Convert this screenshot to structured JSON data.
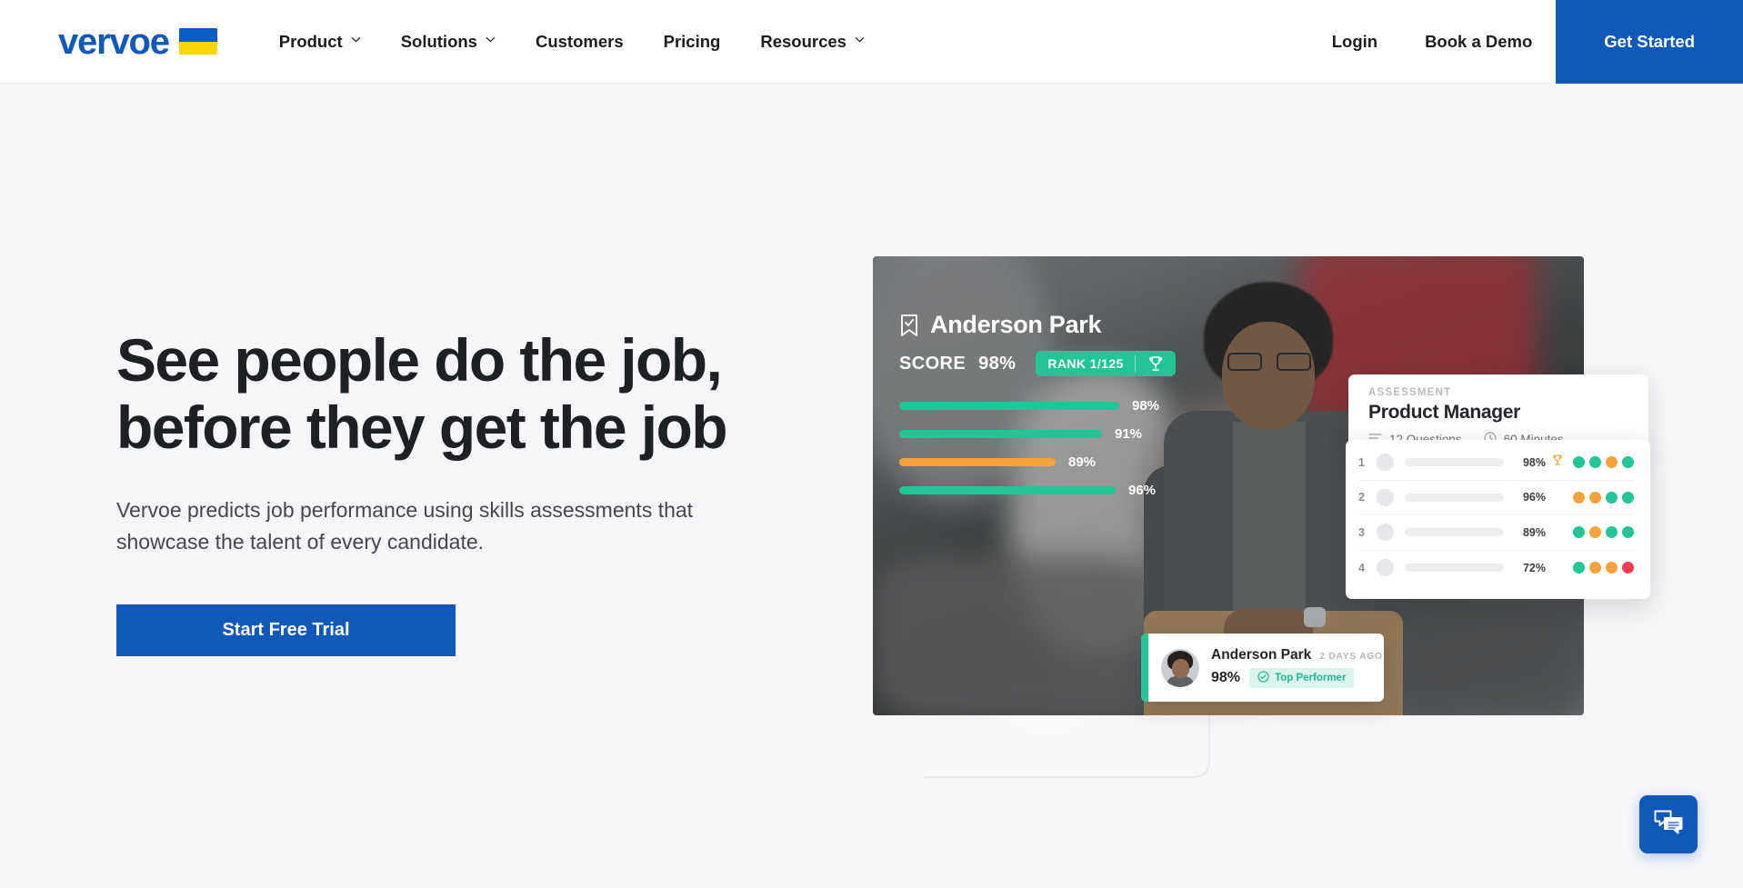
{
  "header": {
    "logo": {
      "text": "vervoe",
      "flag_top_color": "#0b5cc4",
      "flag_bottom_color": "#ffd500",
      "brand_color": "#1059b8"
    },
    "nav": [
      {
        "label": "Product",
        "has_dropdown": true,
        "icon": "chevron-down-icon"
      },
      {
        "label": "Solutions",
        "has_dropdown": true,
        "icon": "chevron-down-icon"
      },
      {
        "label": "Customers",
        "has_dropdown": false
      },
      {
        "label": "Pricing",
        "has_dropdown": false
      },
      {
        "label": "Resources",
        "has_dropdown": true,
        "icon": "chevron-down-icon"
      }
    ],
    "login_label": "Login",
    "demo_label": "Book a Demo",
    "get_started_label": "Get Started"
  },
  "hero": {
    "title": "See people do the job,\nbefore they get the job",
    "subtitle": "Vervoe predicts job performance using skills assessments that\nshowcase the talent of every candidate.",
    "cta_label": "Start Free Trial"
  },
  "visual": {
    "score_overlay": {
      "bookmark_icon": "bookmark-check-icon",
      "candidate_name": "Anderson Park",
      "score_label": "SCORE",
      "score_value": "98%",
      "rank_label": "RANK 1/125",
      "trophy_icon": "trophy-icon",
      "bars": [
        {
          "value": "98%",
          "pct": 98,
          "color": "#23c495"
        },
        {
          "value": "91%",
          "pct": 91,
          "color": "#23c495"
        },
        {
          "value": "89%",
          "pct": 89,
          "color": "#f5a33c"
        },
        {
          "value": "96%",
          "pct": 96,
          "color": "#23c495"
        }
      ]
    },
    "assessment_card": {
      "kicker": "ASSESSMENT",
      "title": "Product Manager",
      "questions_icon": "list-icon",
      "questions": "12 Questions",
      "duration_icon": "clock-icon",
      "duration": "60 Minutes"
    },
    "rank_card": {
      "rows": [
        {
          "rank": "1",
          "pct": "98%",
          "trophy": true,
          "dots": [
            "#23c495",
            "#23c495",
            "#f5a33c",
            "#23c495"
          ]
        },
        {
          "rank": "2",
          "pct": "96%",
          "trophy": false,
          "dots": [
            "#f5a33c",
            "#f5a33c",
            "#23c495",
            "#23c495"
          ]
        },
        {
          "rank": "3",
          "pct": "89%",
          "trophy": false,
          "dots": [
            "#23c495",
            "#f5a33c",
            "#23c495",
            "#23c495"
          ]
        },
        {
          "rank": "4",
          "pct": "72%",
          "trophy": false,
          "dots": [
            "#23c495",
            "#f5a33c",
            "#f5a33c",
            "#f23b54"
          ]
        }
      ]
    },
    "notification_card": {
      "name": "Anderson Park",
      "time_ago": "2 DAYS AGO",
      "score": "98%",
      "badge_icon": "check-circle-icon",
      "badge_label": "Top Performer",
      "accent_color": "#23c495"
    }
  },
  "chat_widget": {
    "icon": "chat-bubbles-icon",
    "color": "#1059b8"
  }
}
